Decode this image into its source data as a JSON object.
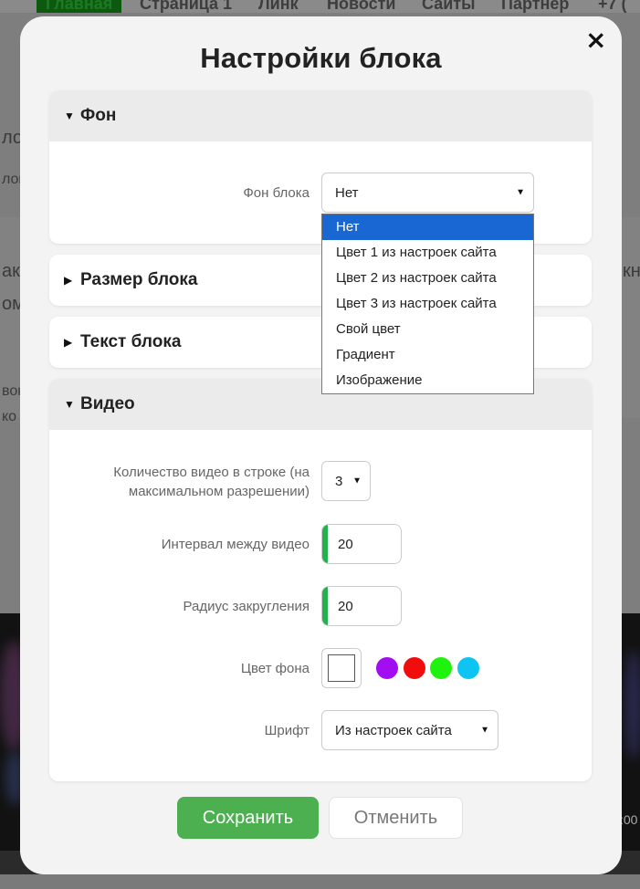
{
  "background": {
    "nav": [
      "Главная",
      "Страница 1",
      "Линк",
      "Новости",
      "Сайты",
      "Партнер",
      "+7 ("
    ],
    "fragments": [
      "ло",
      "лок",
      "ак",
      "ом",
      "вок",
      "ко",
      "кн",
      ":00"
    ]
  },
  "modal": {
    "title": "Настройки блока",
    "close_label": "×",
    "sections": {
      "fon": {
        "title": "Фон",
        "field_label": "Фон блока",
        "selected": "Нет",
        "options": [
          "Нет",
          "Цвет 1 из настроек сайта",
          "Цвет 2 из настроек сайта",
          "Цвет 3 из настроек сайта",
          "Свой цвет",
          "Градиент",
          "Изображение"
        ]
      },
      "size": {
        "title": "Размер блока"
      },
      "text": {
        "title": "Текст блока"
      },
      "video": {
        "title": "Видео",
        "count_label": "Количество видео в строке (на максимальном разрешении)",
        "count_value": "3",
        "interval_label": "Интервал между видео",
        "interval_value": "20",
        "radius_label": "Радиус закругления",
        "radius_value": "20",
        "bgcolor_label": "Цвет фона",
        "swatches": [
          "#a20df2",
          "#f20d0d",
          "#1ff20d",
          "#0dc4f2"
        ],
        "font_label": "Шрифт",
        "font_value": "Из настроек сайта"
      }
    },
    "buttons": {
      "save": "Сохранить",
      "cancel": "Отменить"
    }
  }
}
